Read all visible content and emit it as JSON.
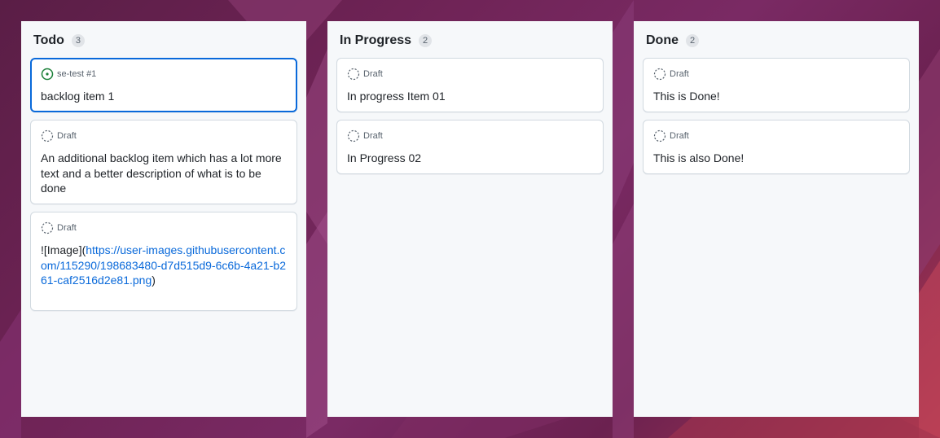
{
  "colors": {
    "column_bg": "#f6f8fa",
    "card_border": "#d1d9e0",
    "selected_border": "#0969da",
    "open_issue_green": "#1a7f37",
    "link": "#0969da"
  },
  "columns": [
    {
      "title": "Todo",
      "count": "3",
      "cards": [
        {
          "icon": "open-issue-icon",
          "meta": "se-test #1",
          "text": "backlog item 1",
          "selected": true
        },
        {
          "icon": "draft-icon",
          "meta": "Draft",
          "text": "An additional backlog item which has a lot more text and a better description of what is to be done"
        },
        {
          "icon": "draft-icon",
          "meta": "Draft",
          "text_prefix": "![Image](",
          "link": "https://user-images.githubusercontent.com/115290/198683480-d7d515d9-6c6b-4a21-b261-caf2516d2e81.png",
          "text_suffix": ")"
        }
      ]
    },
    {
      "title": "In Progress",
      "count": "2",
      "cards": [
        {
          "icon": "draft-icon",
          "meta": "Draft",
          "text": "In progress Item 01"
        },
        {
          "icon": "draft-icon",
          "meta": "Draft",
          "text": "In Progress 02"
        }
      ]
    },
    {
      "title": "Done",
      "count": "2",
      "cards": [
        {
          "icon": "draft-icon",
          "meta": "Draft",
          "text": "This is Done!"
        },
        {
          "icon": "draft-icon",
          "meta": "Draft",
          "text": "This is also Done!"
        }
      ]
    }
  ]
}
